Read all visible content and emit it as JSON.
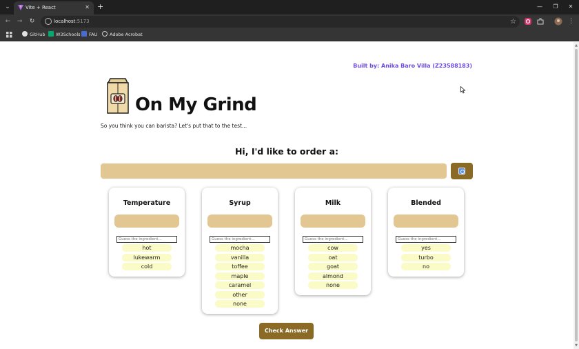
{
  "browser": {
    "tab_title": "Vite + React",
    "tab_close": "✕",
    "new_tab": "+",
    "tab_menu": "⌄",
    "url_host": "localhost",
    "url_port": ":5173",
    "bookmarks": [
      "GitHub",
      "W3Schools",
      "FAU",
      "Adobe Acrobat"
    ],
    "window_controls": [
      "—",
      "❐",
      "✕"
    ]
  },
  "header": {
    "byline": "Built by: Anika Baro Villa (Z23588183)",
    "title": "On My Grind",
    "subtitle": "So you think you can barista? Let's put that to the test..."
  },
  "order": {
    "heading": "Hi, I'd like to order a:"
  },
  "cards": [
    {
      "title": "Temperature",
      "placeholder": "Guess the ingredient...",
      "options": [
        "hot",
        "lukewarm",
        "cold"
      ]
    },
    {
      "title": "Syrup",
      "placeholder": "Guess the ingredient...",
      "options": [
        "mocha",
        "vanilla",
        "toffee",
        "maple",
        "caramel",
        "other",
        "none"
      ]
    },
    {
      "title": "Milk",
      "placeholder": "Guess the ingredient...",
      "options": [
        "cow",
        "oat",
        "goat",
        "almond",
        "none"
      ]
    },
    {
      "title": "Blended",
      "placeholder": "Guess the ingredient...",
      "options": [
        "yes",
        "turbo",
        "no"
      ]
    }
  ],
  "check_button": "Check Answer",
  "colors": {
    "accent_tan": "#e2c792",
    "button_brown": "#8a6a25",
    "option_bg": "#fbfbc8",
    "byline_purple": "#6c4be0"
  }
}
